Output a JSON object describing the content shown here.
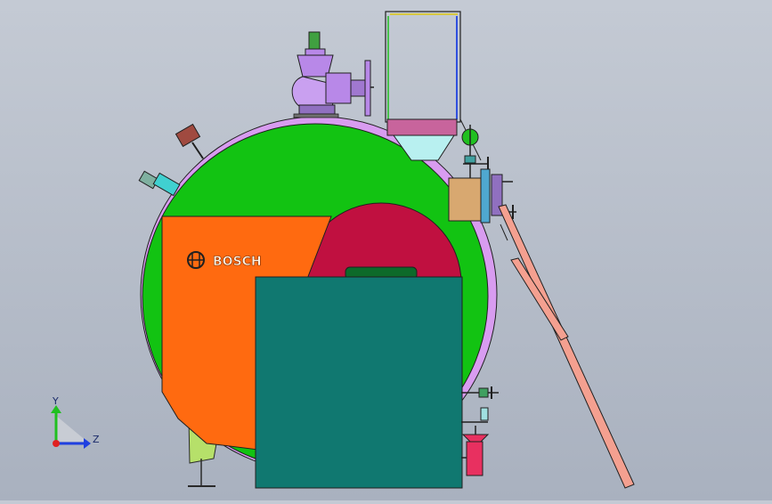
{
  "viewport": {
    "brand_label": "BOSCH",
    "axis_labels": {
      "y": "Y",
      "z": "Z"
    }
  },
  "colors": {
    "shell_green": "#12c312",
    "shell_rim": "#d89cf0",
    "front_panel_orange": "#ff6a10",
    "burner_teal": "#107870",
    "furnace_red": "#c01040",
    "valve_purple": "#b888e8",
    "hopper_pink": "#c8649c",
    "ladder_salmon": "#f4a090",
    "axis_y": "#20c020",
    "axis_z": "#2040e0",
    "axis_origin": "#e02020"
  }
}
